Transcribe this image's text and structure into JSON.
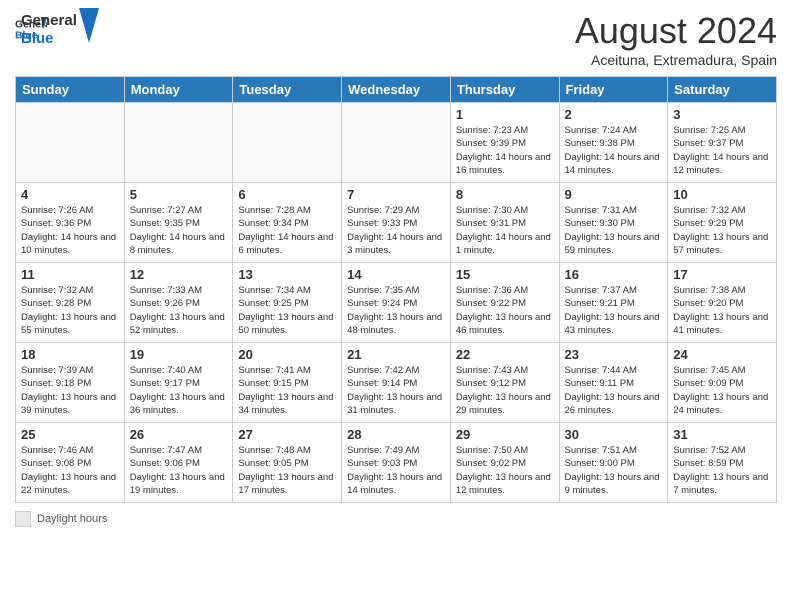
{
  "header": {
    "logo_general": "General",
    "logo_blue": "Blue",
    "month_title": "August 2024",
    "location": "Aceituna, Extremadura, Spain"
  },
  "weekdays": [
    "Sunday",
    "Monday",
    "Tuesday",
    "Wednesday",
    "Thursday",
    "Friday",
    "Saturday"
  ],
  "weeks": [
    [
      {
        "day": "",
        "info": ""
      },
      {
        "day": "",
        "info": ""
      },
      {
        "day": "",
        "info": ""
      },
      {
        "day": "",
        "info": ""
      },
      {
        "day": "1",
        "info": "Sunrise: 7:23 AM\nSunset: 9:39 PM\nDaylight: 14 hours and 16 minutes."
      },
      {
        "day": "2",
        "info": "Sunrise: 7:24 AM\nSunset: 9:38 PM\nDaylight: 14 hours and 14 minutes."
      },
      {
        "day": "3",
        "info": "Sunrise: 7:25 AM\nSunset: 9:37 PM\nDaylight: 14 hours and 12 minutes."
      }
    ],
    [
      {
        "day": "4",
        "info": "Sunrise: 7:26 AM\nSunset: 9:36 PM\nDaylight: 14 hours and 10 minutes."
      },
      {
        "day": "5",
        "info": "Sunrise: 7:27 AM\nSunset: 9:35 PM\nDaylight: 14 hours and 8 minutes."
      },
      {
        "day": "6",
        "info": "Sunrise: 7:28 AM\nSunset: 9:34 PM\nDaylight: 14 hours and 6 minutes."
      },
      {
        "day": "7",
        "info": "Sunrise: 7:29 AM\nSunset: 9:33 PM\nDaylight: 14 hours and 3 minutes."
      },
      {
        "day": "8",
        "info": "Sunrise: 7:30 AM\nSunset: 9:31 PM\nDaylight: 14 hours and 1 minute."
      },
      {
        "day": "9",
        "info": "Sunrise: 7:31 AM\nSunset: 9:30 PM\nDaylight: 13 hours and 59 minutes."
      },
      {
        "day": "10",
        "info": "Sunrise: 7:32 AM\nSunset: 9:29 PM\nDaylight: 13 hours and 57 minutes."
      }
    ],
    [
      {
        "day": "11",
        "info": "Sunrise: 7:32 AM\nSunset: 9:28 PM\nDaylight: 13 hours and 55 minutes."
      },
      {
        "day": "12",
        "info": "Sunrise: 7:33 AM\nSunset: 9:26 PM\nDaylight: 13 hours and 52 minutes."
      },
      {
        "day": "13",
        "info": "Sunrise: 7:34 AM\nSunset: 9:25 PM\nDaylight: 13 hours and 50 minutes."
      },
      {
        "day": "14",
        "info": "Sunrise: 7:35 AM\nSunset: 9:24 PM\nDaylight: 13 hours and 48 minutes."
      },
      {
        "day": "15",
        "info": "Sunrise: 7:36 AM\nSunset: 9:22 PM\nDaylight: 13 hours and 46 minutes."
      },
      {
        "day": "16",
        "info": "Sunrise: 7:37 AM\nSunset: 9:21 PM\nDaylight: 13 hours and 43 minutes."
      },
      {
        "day": "17",
        "info": "Sunrise: 7:38 AM\nSunset: 9:20 PM\nDaylight: 13 hours and 41 minutes."
      }
    ],
    [
      {
        "day": "18",
        "info": "Sunrise: 7:39 AM\nSunset: 9:18 PM\nDaylight: 13 hours and 39 minutes."
      },
      {
        "day": "19",
        "info": "Sunrise: 7:40 AM\nSunset: 9:17 PM\nDaylight: 13 hours and 36 minutes."
      },
      {
        "day": "20",
        "info": "Sunrise: 7:41 AM\nSunset: 9:15 PM\nDaylight: 13 hours and 34 minutes."
      },
      {
        "day": "21",
        "info": "Sunrise: 7:42 AM\nSunset: 9:14 PM\nDaylight: 13 hours and 31 minutes."
      },
      {
        "day": "22",
        "info": "Sunrise: 7:43 AM\nSunset: 9:12 PM\nDaylight: 13 hours and 29 minutes."
      },
      {
        "day": "23",
        "info": "Sunrise: 7:44 AM\nSunset: 9:11 PM\nDaylight: 13 hours and 26 minutes."
      },
      {
        "day": "24",
        "info": "Sunrise: 7:45 AM\nSunset: 9:09 PM\nDaylight: 13 hours and 24 minutes."
      }
    ],
    [
      {
        "day": "25",
        "info": "Sunrise: 7:46 AM\nSunset: 9:08 PM\nDaylight: 13 hours and 22 minutes."
      },
      {
        "day": "26",
        "info": "Sunrise: 7:47 AM\nSunset: 9:06 PM\nDaylight: 13 hours and 19 minutes."
      },
      {
        "day": "27",
        "info": "Sunrise: 7:48 AM\nSunset: 9:05 PM\nDaylight: 13 hours and 17 minutes."
      },
      {
        "day": "28",
        "info": "Sunrise: 7:49 AM\nSunset: 9:03 PM\nDaylight: 13 hours and 14 minutes."
      },
      {
        "day": "29",
        "info": "Sunrise: 7:50 AM\nSunset: 9:02 PM\nDaylight: 13 hours and 12 minutes."
      },
      {
        "day": "30",
        "info": "Sunrise: 7:51 AM\nSunset: 9:00 PM\nDaylight: 13 hours and 9 minutes."
      },
      {
        "day": "31",
        "info": "Sunrise: 7:52 AM\nSunset: 8:59 PM\nDaylight: 13 hours and 7 minutes."
      }
    ]
  ],
  "footer": {
    "label": "Daylight hours"
  }
}
